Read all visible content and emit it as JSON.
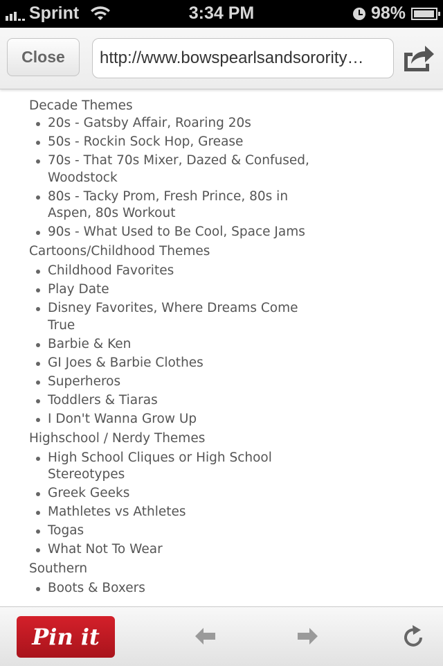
{
  "status_bar": {
    "carrier": "Sprint",
    "time": "3:34 PM",
    "battery": "98%",
    "battery_level": 0.98
  },
  "toolbar": {
    "close_label": "Close",
    "url": "http://www.bowspearlsandsorority…"
  },
  "content": {
    "sections": [
      {
        "title": "Decade Themes",
        "items": [
          "20s - Gatsby Affair, Roaring 20s",
          "50s - Rockin Sock Hop, Grease",
          "70s - That 70s Mixer, Dazed & Confused, Woodstock",
          "80s - Tacky Prom, Fresh Prince, 80s in Aspen, 80s Workout",
          "90s - What Used to Be Cool, Space Jams"
        ]
      },
      {
        "title": "Cartoons/Childhood Themes",
        "items": [
          "Childhood Favorites",
          "Play Date",
          "Disney Favorites, Where Dreams Come True",
          "Barbie & Ken",
          "GI Joes & Barbie Clothes",
          "Superheros",
          "Toddlers & Tiaras",
          "I Don't Wanna Grow Up"
        ]
      },
      {
        "title": "Highschool / Nerdy Themes",
        "items": [
          "High School Cliques or High School Stereotypes",
          "Greek Geeks",
          "Mathletes vs Athletes",
          "Togas",
          "What Not To Wear"
        ]
      },
      {
        "title": "Southern",
        "items": [
          "Boots & Boxers"
        ]
      }
    ]
  },
  "bottom_bar": {
    "pin_label": "Pin it",
    "pin_color": "#c41a22",
    "back_icon": "arrow-left-icon",
    "forward_icon": "arrow-right-icon",
    "reload_icon": "reload-icon"
  }
}
